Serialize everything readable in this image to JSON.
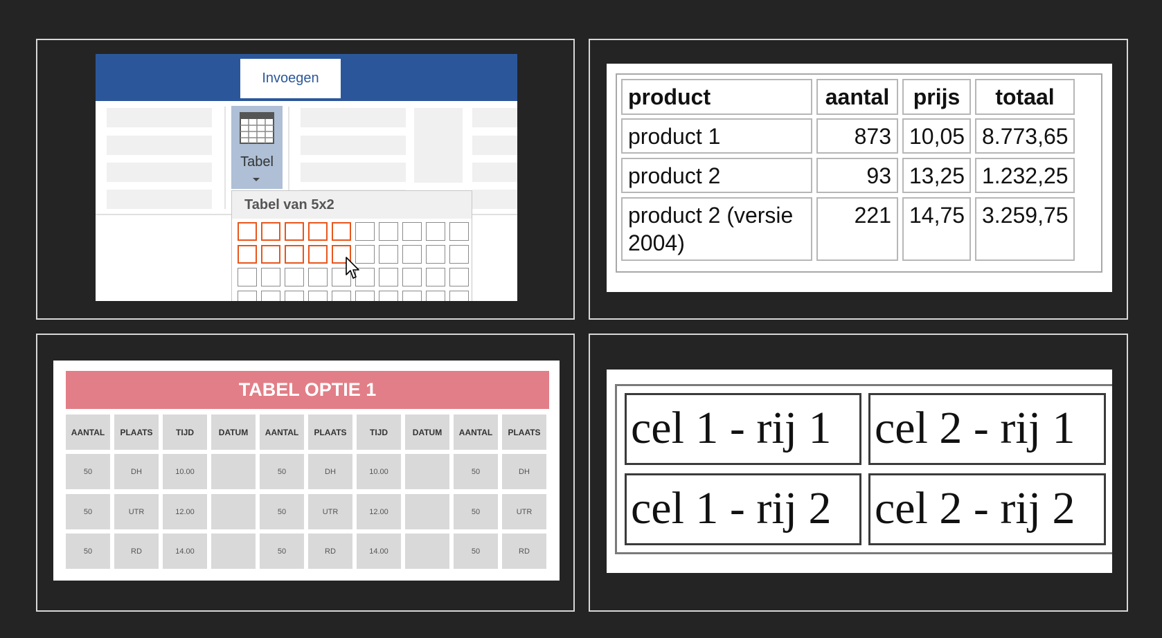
{
  "panel1": {
    "tab_label": "Invoegen",
    "button_label": "Tabel",
    "dropdown_title": "Tabel van 5x2",
    "icons": {
      "table": "table-icon",
      "dropdown": "chevron-down-icon",
      "cursor": "mouse-pointer-icon"
    },
    "grid": {
      "columns": 10,
      "rows_visible": 4,
      "selected_columns": 5,
      "selected_rows": 2
    },
    "colors": {
      "ribbon": "#2b579a",
      "highlight": "#e8561c",
      "button_active": "#aebfd6"
    }
  },
  "panel2": {
    "headers": [
      "product",
      "aantal",
      "prijs",
      "totaal"
    ],
    "rows": [
      [
        "product 1",
        "873",
        "10,05",
        "8.773,65"
      ],
      [
        "product 2",
        "93",
        "13,25",
        "1.232,25"
      ],
      [
        "product 2 (versie 2004)",
        "221",
        "14,75",
        "3.259,75"
      ]
    ]
  },
  "panel3": {
    "title": "TABEL OPTIE 1",
    "headers": [
      "AANTAL",
      "PLAATS",
      "TIJD",
      "DATUM",
      "AANTAL",
      "PLAATS",
      "TIJD",
      "DATUM",
      "AANTAL",
      "PLAATS"
    ],
    "rows": [
      [
        "50",
        "DH",
        "10.00",
        "",
        "50",
        "DH",
        "10.00",
        "",
        "50",
        "DH"
      ],
      [
        "50",
        "UTR",
        "12.00",
        "",
        "50",
        "UTR",
        "12.00",
        "",
        "50",
        "UTR"
      ],
      [
        "50",
        "RD",
        "14.00",
        "",
        "50",
        "RD",
        "14.00",
        "",
        "50",
        "RD"
      ]
    ],
    "colors": {
      "title_bg": "#e27e87",
      "cell_bg": "#d9d9d9"
    }
  },
  "panel4": {
    "cells": [
      [
        "cel 1 - rij 1",
        "cel 2 - rij 1"
      ],
      [
        "cel 1 - rij 2",
        "cel 2 - rij 2"
      ]
    ]
  }
}
